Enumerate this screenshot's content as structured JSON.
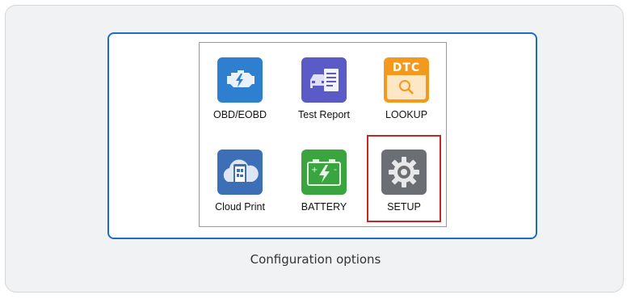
{
  "screen": {
    "tiles": [
      {
        "label": "OBD/EOBD",
        "icon": "engine-icon",
        "color": "#2f7fd0"
      },
      {
        "label": "Test Report",
        "icon": "report-icon",
        "color": "#5b5bc7"
      },
      {
        "label": "LOOKUP",
        "icon": "dtc-lookup-icon",
        "color": "#f39a1e",
        "icon_text": "DTC"
      },
      {
        "label": "Cloud Print",
        "icon": "cloud-print-icon",
        "color": "#3d6fb6"
      },
      {
        "label": "BATTERY",
        "icon": "battery-icon",
        "color": "#3aa53f"
      },
      {
        "label": "SETUP",
        "icon": "gear-icon",
        "color": "#6b6e73"
      }
    ],
    "selected": "SETUP",
    "selection_color": "#c62828"
  },
  "caption": "Configuration options",
  "colors": {
    "frame": "#1a6fc4"
  }
}
